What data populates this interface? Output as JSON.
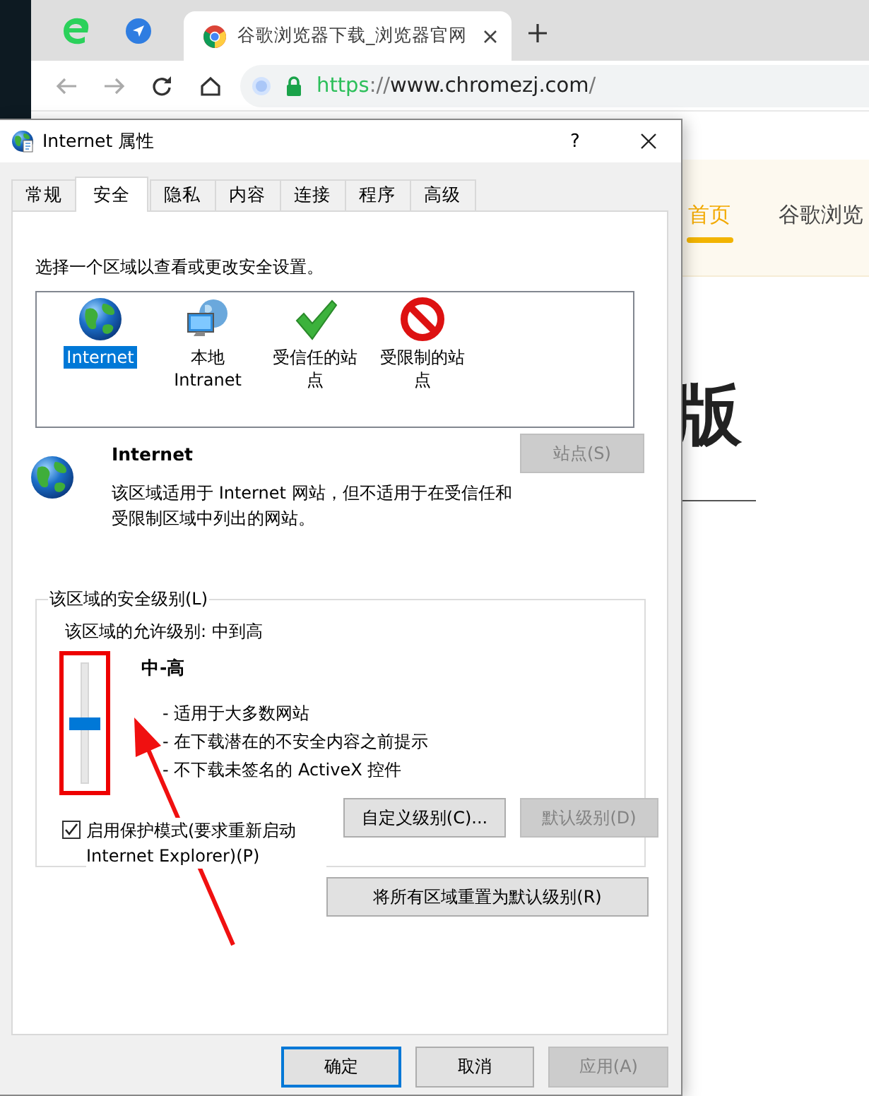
{
  "browser": {
    "tab_title": "谷歌浏览器下载_浏览器官网",
    "url": [
      {
        "kind": "scheme",
        "text": "https"
      },
      {
        "kind": "separator",
        "text": "://"
      },
      {
        "kind": "host",
        "text": "www.chromezj.com"
      },
      {
        "kind": "separator",
        "text": "/"
      }
    ],
    "nav": [
      {
        "label": "首页",
        "selected": true
      },
      {
        "label": "谷歌浏览",
        "selected": false
      }
    ],
    "heading": "版"
  },
  "dialog": {
    "title": "Internet 属性",
    "help_button": "?",
    "tabs": [
      {
        "label": "常规",
        "selected": false
      },
      {
        "label": "安全",
        "selected": true
      },
      {
        "label": "隐私",
        "selected": false
      },
      {
        "label": "内容",
        "selected": false
      },
      {
        "label": "连接",
        "selected": false
      },
      {
        "label": "程序",
        "selected": false
      },
      {
        "label": "高级",
        "selected": false
      }
    ],
    "prompt": "选择一个区域以查看或更改安全设置。",
    "zones": [
      {
        "kind": "internet",
        "label": "Internet",
        "selected": true
      },
      {
        "kind": "intranet",
        "label": "本地 Intranet",
        "selected": false
      },
      {
        "kind": "trusted",
        "label": "受信任的站点",
        "selected": false
      },
      {
        "kind": "restricted",
        "label": "受限制的站点",
        "selected": false
      }
    ],
    "zone_info": {
      "title": "Internet",
      "description": "该区域适用于 Internet 网站，但不适用于在受信任和受限制区域中列出的网站。",
      "sites_button": {
        "label": "站点(S)",
        "disabled": true
      }
    },
    "security_level": {
      "legend": "该区域的安全级别(L)",
      "allowed": "该区域的允许级别: 中到高",
      "level": 0.5,
      "level_name": "中-高",
      "bullets": [
        "- 适用于大多数网站",
        "- 在下载潜在的不安全内容之前提示",
        "- 不下载未签名的 ActiveX 控件"
      ],
      "protected_mode": {
        "label": "启用保护模式(要求重新启动 Internet Explorer)(P)",
        "checked": true
      },
      "buttons": [
        {
          "label": "自定义级别(C)...",
          "disabled": false
        },
        {
          "label": "默认级别(D)",
          "disabled": true
        }
      ]
    },
    "reset_button": {
      "label": "将所有区域重置为默认级别(R)",
      "disabled": false
    },
    "footer_buttons": [
      {
        "label": "确定",
        "default": true,
        "disabled": false
      },
      {
        "label": "取消",
        "default": false,
        "disabled": false
      },
      {
        "label": "应用(A)",
        "default": false,
        "disabled": true
      }
    ]
  }
}
